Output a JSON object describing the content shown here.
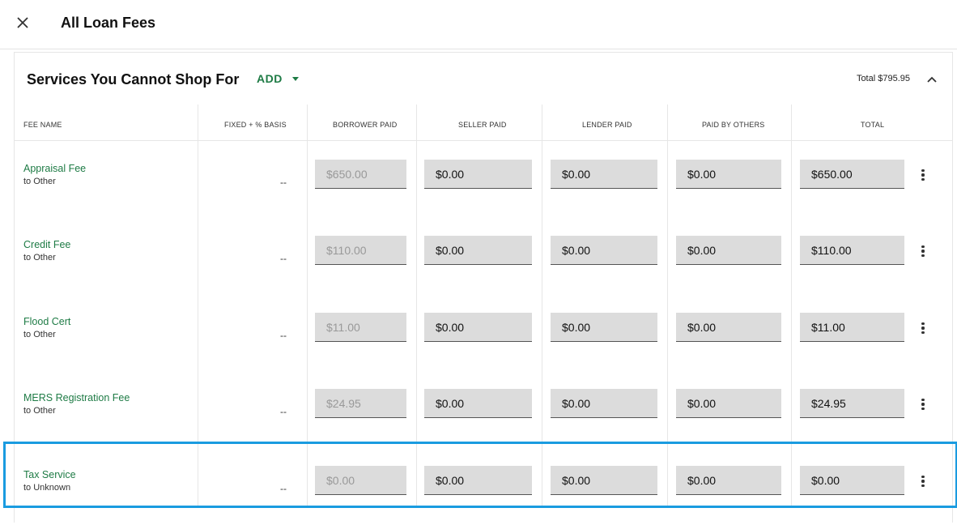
{
  "header": {
    "title": "All Loan Fees",
    "close_icon": "close-icon"
  },
  "section": {
    "title": "Services You Cannot Shop For",
    "add_label": "ADD",
    "total_label": "Total $795.95",
    "collapse_icon": "chevron-up-icon"
  },
  "columns": [
    "FEE NAME",
    "FIXED + % BASIS",
    "BORROWER PAID",
    "SELLER PAID",
    "LENDER PAID",
    "PAID BY OTHERS",
    "TOTAL"
  ],
  "rows": [
    {
      "name": "Appraisal Fee",
      "to": "to Other",
      "basis": "--",
      "borrower": "$650.00",
      "seller": "$0.00",
      "lender": "$0.00",
      "others": "$0.00",
      "total": "$650.00"
    },
    {
      "name": "Credit Fee",
      "to": "to Other",
      "basis": "--",
      "borrower": "$110.00",
      "seller": "$0.00",
      "lender": "$0.00",
      "others": "$0.00",
      "total": "$110.00"
    },
    {
      "name": "Flood Cert",
      "to": "to Other",
      "basis": "--",
      "borrower": "$11.00",
      "seller": "$0.00",
      "lender": "$0.00",
      "others": "$0.00",
      "total": "$11.00"
    },
    {
      "name": "MERS Registration Fee",
      "to": "to Other",
      "basis": "--",
      "borrower": "$24.95",
      "seller": "$0.00",
      "lender": "$0.00",
      "others": "$0.00",
      "total": "$24.95"
    },
    {
      "name": "Tax Service",
      "to": "to Unknown",
      "basis": "--",
      "borrower": "$0.00",
      "seller": "$0.00",
      "lender": "$0.00",
      "others": "$0.00",
      "total": "$0.00"
    }
  ],
  "colors": {
    "accent": "#1e7b45",
    "highlight": "#1a9be0"
  }
}
